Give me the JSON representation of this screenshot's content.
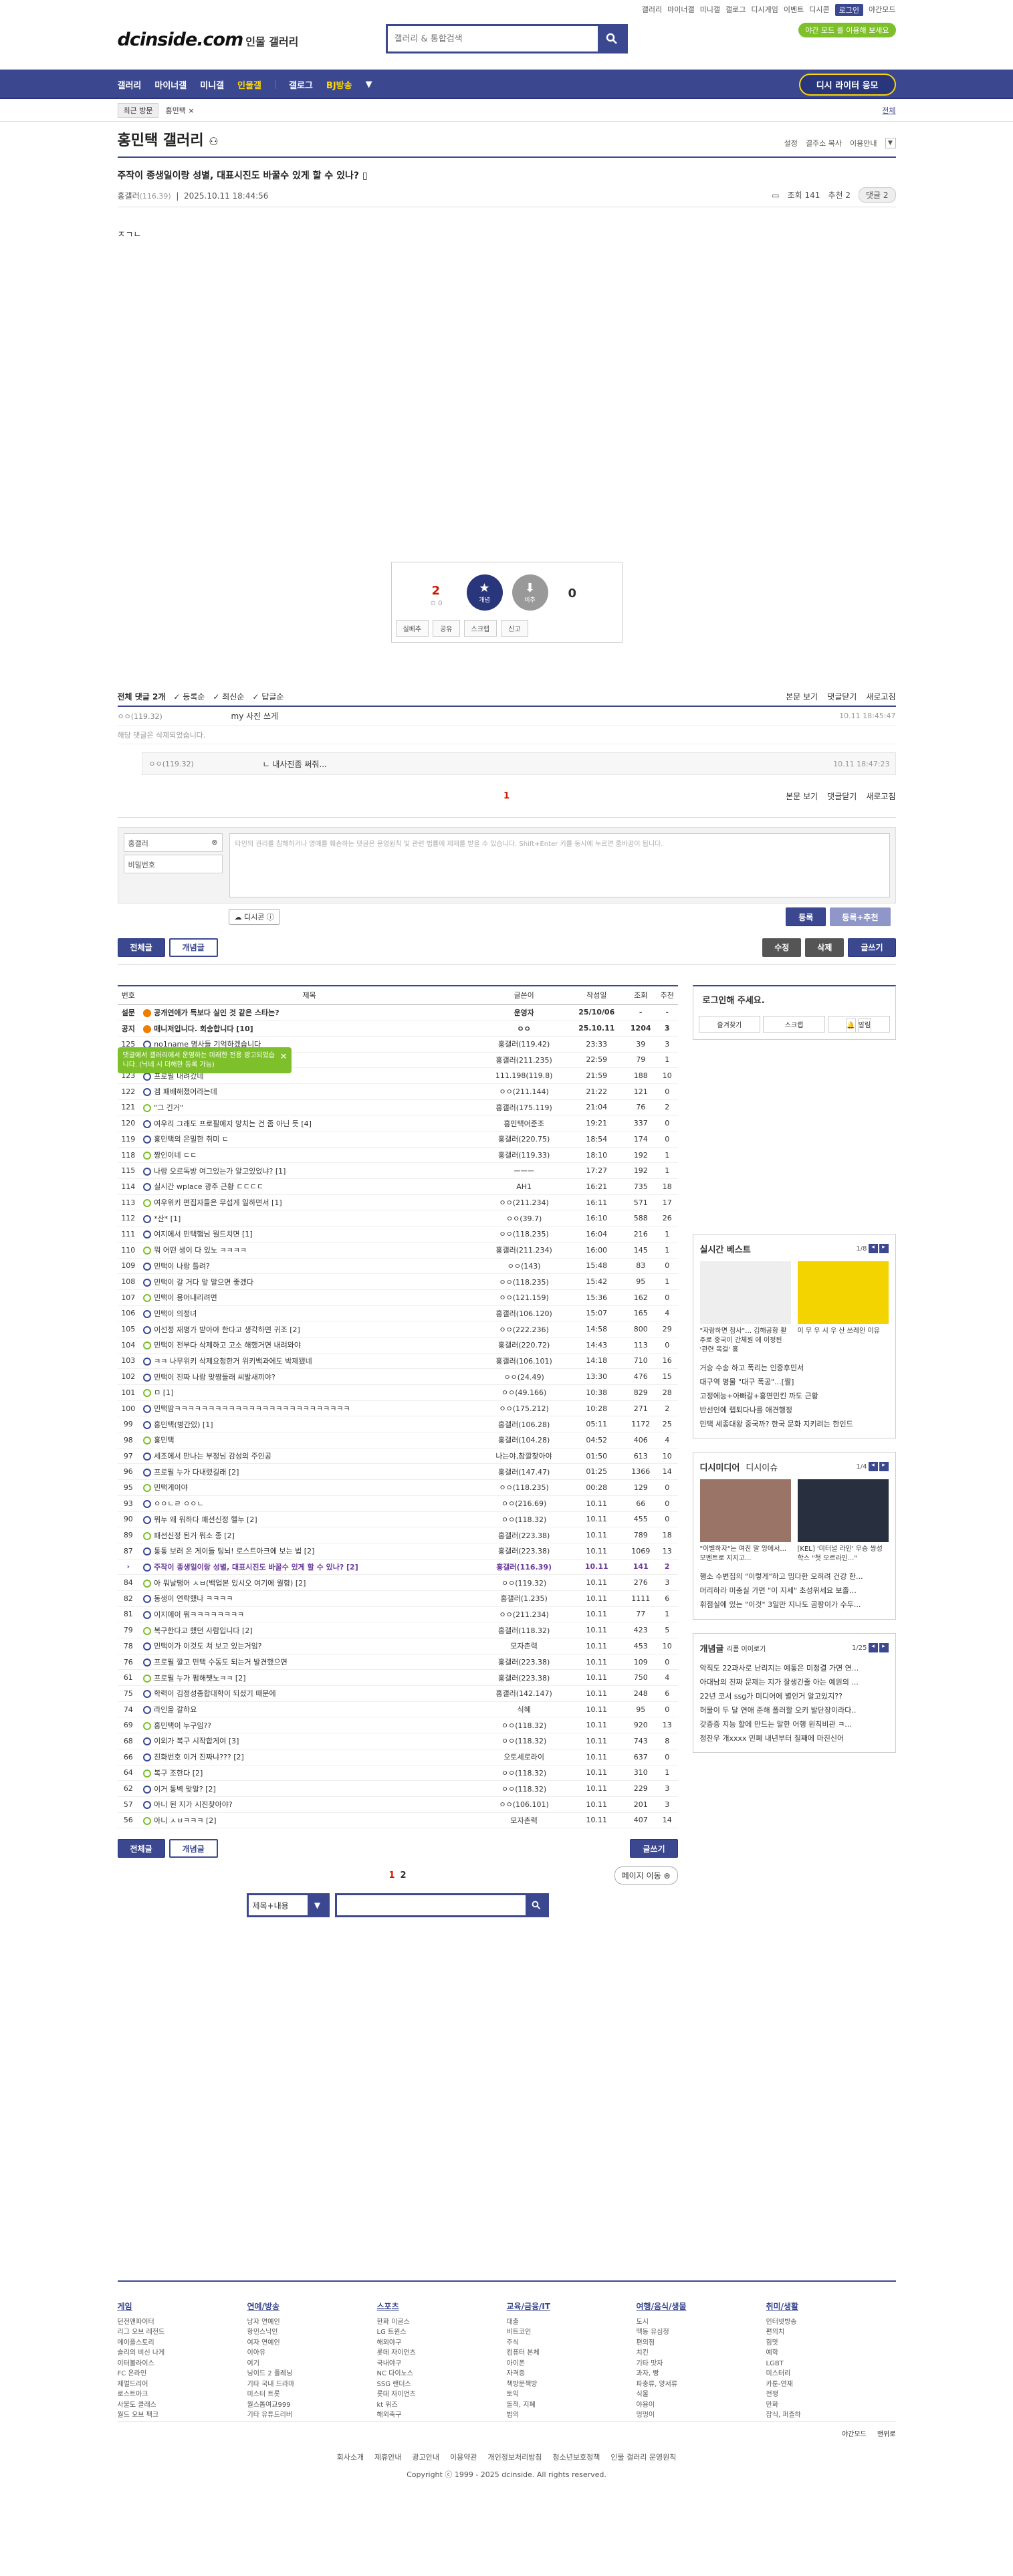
{
  "util_nav": [
    "갤러리",
    "마이너갤",
    "미니갤",
    "갤로그",
    "디시게임",
    "이벤트",
    "디시콘",
    "로그인",
    "야간모드"
  ],
  "logo": {
    "main": "dcinside.com",
    "sub": "인물 갤러리"
  },
  "search": {
    "placeholder": "갤러리 & 통합검색"
  },
  "promo": "야간 모드 를 이용해 보세요",
  "gnb": {
    "items": [
      "갤러리",
      "마이너갤",
      "미니갤",
      "인물갤",
      "갤로그",
      "BJ방송"
    ],
    "gallery_btn": "디시 라이터 응모"
  },
  "recent": {
    "label": "최근 방문",
    "item": "홍민택 ×",
    "all": "전체"
  },
  "gallery": {
    "title": "홍민택 갤러리",
    "opts": [
      "설정",
      "결주소 복사",
      "이용안내"
    ]
  },
  "post": {
    "title": "주작이 종생일이랑 성별, 대표시진도 바꿀수 있게 할 수 있나?",
    "writer": "홍갤러",
    "ip": "(116.39)",
    "date": "2025.10.11 18:44:56",
    "views": "조회 141",
    "recommend": "추천 2",
    "comments": "댓글 2",
    "body": "ㅈㄱㄴ"
  },
  "vote": {
    "up": "2",
    "up_sub": "0",
    "up_label": "개념",
    "down_label": "비추",
    "down": "0",
    "actions": [
      "실베추",
      "공유",
      "스크랩",
      "신고"
    ]
  },
  "comments": {
    "header": {
      "total": "전체 댓글 2개",
      "sort": [
        "등록순",
        "최신순",
        "답글순"
      ],
      "right": [
        "본문 보기",
        "댓글닫기",
        "새로고침"
      ]
    },
    "items": [
      {
        "nick": "ㅇㅇ(119.32)",
        "text": "my 사진 쓰게",
        "date": "10.11 18:45:47"
      }
    ],
    "deleted": "해당 댓글은 삭제되었습니다.",
    "reply": {
      "nick": "ㅇㅇ(119.32)",
      "text": "ㄴ 내사진좀 써줘...",
      "date": "10.11 18:47:23"
    },
    "page": "1",
    "toast": "댓글에서 갤러리에서 운영하는 미래한 전용 광고되었습니다. (닉네 시 더해한 등록 가능)",
    "write": {
      "nick": "홍갤러",
      "pw": "비밀번호",
      "placeholder": "타인의 권리를 침해하거나 명예를 훼손하는 댓글은 운영원칙 및 관련 법률에 제재를 받을 수 있습니다. Shift+Enter 키를 동시에 누르면 줄바꿈이 됩니다.",
      "dccon": "디시콘",
      "submit": "등록",
      "submit2": "등록+추천"
    }
  },
  "tabs": {
    "all": "전체글",
    "best": "개념글",
    "modify": "수정",
    "delete": "삭제",
    "write": "글쓰기"
  },
  "list": {
    "headers": [
      "번호",
      "제목",
      "글쓴이",
      "작성일",
      "조회",
      "추천"
    ],
    "rows": [
      [
        "설문",
        "공개연애가 득보다 실인 것 같은 스타는?",
        "운영자",
        "25/10/06",
        "-",
        "-"
      ],
      [
        "공지",
        "매니저입니다. 회송합니다 [10]",
        "ㅇㅇ",
        "25.10.11",
        "1204",
        "3"
      ],
      [
        "125",
        "no1name 명사들 기억하겠습니다",
        "홍갤러(119.42)",
        "23:33",
        "39",
        "3"
      ],
      [
        "124",
        "홍민택 프로필 복구했습니다",
        "홍갤러(211.235)",
        "22:59",
        "79",
        "1"
      ],
      [
        "123",
        "프로필 내려갔네",
        "111.198(119.8)",
        "21:59",
        "188",
        "10"
      ],
      [
        "122",
        "겜 패배해졌어라는데",
        "ㅇㅇ(211.144)",
        "21:22",
        "121",
        "0"
      ],
      [
        "121",
        "\"그 긴거\"",
        "홍갤러(175.119)",
        "21:04",
        "76",
        "2"
      ],
      [
        "120",
        "여우리 그래도 프로필에지 망치는 건 좀 아닌 듯 [4]",
        "홍민택어준조",
        "19:21",
        "337",
        "0"
      ],
      [
        "119",
        "홍민택의 은밀한 취미 ㄷ",
        "홍갤러(220.75)",
        "18:54",
        "174",
        "0"
      ],
      [
        "118",
        "짱인이네 ㄷㄷ",
        "홍갤러(119.33)",
        "18:10",
        "192",
        "1"
      ],
      [
        "115",
        "나랑 오르독방 여그있는가 알고있었냐? [1]",
        "ㅡㅡㅡ",
        "17:27",
        "192",
        "1"
      ],
      [
        "114",
        "실시간 wplace 광주 근황 ㄷㄷㄷㄷ",
        "AH1",
        "16:21",
        "735",
        "18"
      ],
      [
        "113",
        "여우위키 편집자들은 무섭게 일하면서 [1]",
        "ㅇㅇ(211.234)",
        "16:11",
        "571",
        "17"
      ],
      [
        "112",
        "*산* [1]",
        "ㅇㅇ(39.7)",
        "16:10",
        "588",
        "26"
      ],
      [
        "111",
        "여지에서 민택햄님 월드치면 [1]",
        "ㅇㅇ(118.235)",
        "16:04",
        "216",
        "1"
      ],
      [
        "110",
        "뭐 어떤 생이 다 있노 ㅋㅋㅋㅋ",
        "홍갤러(211.234)",
        "16:00",
        "145",
        "1"
      ],
      [
        "109",
        "민택이 나랑 틀려?",
        "ㅇㅇ(143)",
        "15:48",
        "83",
        "0"
      ],
      [
        "108",
        "민택이 갈 거다 앞 말으면 좋겠다",
        "ㅇㅇ(118.235)",
        "15:42",
        "95",
        "1"
      ],
      [
        "107",
        "민택이 용어내리려면",
        "ㅇㅇ(121.159)",
        "15:36",
        "162",
        "0"
      ],
      [
        "106",
        "민택이 의정녀",
        "홍갤러(106.120)",
        "15:07",
        "165",
        "4"
      ],
      [
        "105",
        "이선정 재명가 받아야 한다고 생각하면 귀조 [2]",
        "ㅇㅇ(222.236)",
        "14:58",
        "800",
        "29"
      ],
      [
        "104",
        "민택이 전부다 삭제하고 고소 해했거면 내려와야",
        "홍갤러(220.72)",
        "14:43",
        "113",
        "0"
      ],
      [
        "103",
        "ㅋㅋ 나무위키 삭제요청한거 위키백과에도 박제됐네",
        "홍갤러(106.101)",
        "14:18",
        "710",
        "16"
      ],
      [
        "102",
        "민택이 진짜 나랑 맞짱들래 씨발새끼야?",
        "ㅇㅇ(24.49)",
        "13:30",
        "476",
        "15"
      ],
      [
        "101",
        "ㅁ [1]",
        "ㅇㅇ(49.166)",
        "10:38",
        "829",
        "28"
      ],
      [
        "100",
        "민택땀ㅋㅋㅋㅋㅋㅋㅋㅋㅋㅋㅋㅋㅋㅋㅋㅋㅋㅋㅋㅋㅋㅋㅋㅋㅋㅋ",
        "ㅇㅇ(175.212)",
        "10:28",
        "271",
        "2"
      ],
      [
        "99",
        "홍민택(병간있) [1]",
        "홍갤러(106.28)",
        "05:11",
        "1172",
        "25"
      ],
      [
        "98",
        "홍민택",
        "홍갤러(104.28)",
        "04:52",
        "406",
        "4"
      ],
      [
        "97",
        "세조에서 만나는 부정님 감성의 주인공",
        "나는야,참깔찾아야",
        "01:50",
        "613",
        "10"
      ],
      [
        "96",
        "프로필 누가 다내렸길래 [2]",
        "홍갤러(147.47)",
        "01:25",
        "1366",
        "14"
      ],
      [
        "95",
        "민택게이야",
        "ㅇㅇ(118.235)",
        "00:28",
        "129",
        "0"
      ],
      [
        "93",
        "ㅇㅇㄴㄹ ㅇㅇㄴ",
        "ㅇㅇ(216.69)",
        "10.11",
        "66",
        "0"
      ],
      [
        "90",
        "뭐누 왜 워하다 패션신정 헬누 [2]",
        "ㅇㅇ(118.32)",
        "10.11",
        "455",
        "0"
      ],
      [
        "89",
        "패션신정 된거 뭐소 종 [2]",
        "홍갤러(223.38)",
        "10.11",
        "789",
        "18"
      ],
      [
        "87",
        "통통 보러 온 게이들 팅뇌! 로스트아크에 보는 법 [2]",
        "홍갤러(223.38)",
        "10.11",
        "1069",
        "13"
      ],
      [
        "›",
        "주작이 종생일이랑 성별, 대표시진도 바꿀수 있게 할 수 있나? [2]",
        "홍갤러(116.39)",
        "10.11",
        "141",
        "2"
      ],
      [
        "84",
        "아 뭐날땡어 ㅅㅂ(백업본 있시오 여기에 월함) [2]",
        "ㅇㅇ(119.32)",
        "10.11",
        "276",
        "3"
      ],
      [
        "82",
        "동생이 연락했나 ㅋㅋㅋㅋ",
        "홍갤러(1.235)",
        "10.11",
        "1111",
        "6"
      ],
      [
        "81",
        "이지에이 뭐ㅋㅋㅋㅋㅋㅋㅋㅋ",
        "ㅇㅇ(211.234)",
        "10.11",
        "77",
        "1"
      ],
      [
        "79",
        "복구한다고 했던 사람입니다 [2]",
        "홍갤러(118.32)",
        "10.11",
        "423",
        "5"
      ],
      [
        "78",
        "민택이가 이것도 쳐 보고 있는거임?",
        "모자촌력",
        "10.11",
        "453",
        "10"
      ],
      [
        "76",
        "프로필 깔고 민택 수동도 되는거 발견했으면",
        "홍갤러(223.38)",
        "10.11",
        "109",
        "0"
      ],
      [
        "61",
        "프로필 누가 펌해쨋노ㅋㅋ [2]",
        "홍갤러(223.38)",
        "10.11",
        "750",
        "4"
      ],
      [
        "75",
        "학력이 김정성종합대학이 되셨기 때문에",
        "홍갤러(142.147)",
        "10.11",
        "248",
        "6"
      ],
      [
        "74",
        "라인을 갈하요",
        "식혜",
        "10.11",
        "95",
        "0"
      ],
      [
        "69",
        "홍민택이 누구임??",
        "ㅇㅇ(118.32)",
        "10.11",
        "920",
        "13"
      ],
      [
        "68",
        "이외가 복구 시작합게여 [3]",
        "ㅇㅇ(118.32)",
        "10.11",
        "743",
        "8"
      ],
      [
        "66",
        "진화번호 이거 진짜냐??? [2]",
        "오토세로라이",
        "10.11",
        "637",
        "0"
      ],
      [
        "64",
        "복구 조한다 [2]",
        "ㅇㅇ(118.32)",
        "10.11",
        "310",
        "1"
      ],
      [
        "62",
        "이거 통벽 맞말? [2]",
        "ㅇㅇ(118.32)",
        "10.11",
        "229",
        "3"
      ],
      [
        "57",
        "아니 된 지가 시진찾아야?",
        "ㅇㅇ(106.101)",
        "10.11",
        "201",
        "3"
      ],
      [
        "56",
        "아니 ㅅㅂㅋㅋㅋ [2]",
        "모자촌력",
        "10.11",
        "407",
        "14"
      ]
    ]
  },
  "pager": {
    "pages": [
      "1",
      "2"
    ],
    "move": "페이지 이동"
  },
  "bsearch": {
    "select": "제목+내용"
  },
  "side": {
    "login": {
      "title": "로그인해 주세요.",
      "btns": [
        "즐겨찾기",
        "스크랩",
        "알림"
      ]
    },
    "best": {
      "title": "실시간 베스트",
      "page": "1/8",
      "thumbs": [
        "\"자랑하면 참사\"… 김해공항 활주로 중국이 간체원 에 이정된 '관련 목걸' 홍",
        "이 무 우 시 우 산 쓰레인 이유"
      ],
      "items": [
        "거승 수송 하고 폭리는 인증후민서",
        "대구역 명물 \"대구 폭공\"...[짤]",
        "고정에능+아빠갈+홍면민킨 까도 근황",
        "반선인에 랩퇴다나를 애견행정",
        "민택 세종대왕 중국까? 한국 문화 지키려는 한인드"
      ]
    },
    "dc": {
      "title": "디시미디어",
      "sub": "디시이슈",
      "page": "1/4",
      "thumbs": [
        "\"이별하자\"는 여친 말 앙에서...모멘트로 지지고...",
        "[KEL] '미터널 라인' 우승 쌍성 학스 \"첫 오르라인...\""
      ],
      "items": [
        "행소 수변집의 \"이렇게\"하고 밈다한 오히려 건강 한...",
        "머리하라 미충실 가면 \"이 지세\" 초성위세요 보졸…",
        "휘점실에 있는 \"이것\" 3일만 지나도 곰팡이가 수두..."
      ]
    },
    "concept": {
      "title": "개념글",
      "sub": "리폼 이이로기",
      "page": "1/25",
      "items": [
        "악직도 22과사로 난리지는 예통은 미정결 가면 연...",
        "아대남의 진짜 문제는 지가 잘생긴줄 아는 예원의 ...",
        "22년 코서 ssg가 미디어에 별인거 알고있지??",
        "허물이 두 달 연애 준해 폴러할 오키 발단장이라다..",
        "갖증증 지능 할에 만드는 말한 어행 원칙비관 ㅋ...",
        "정찬우 개xxxx 민폐 내년부터 질째에 마진신어"
      ]
    }
  },
  "footer": {
    "cols": [
      {
        "title": "게임",
        "items": [
          "던전앤파이터",
          "리그 오브 레전드",
          "메이플스토리",
          "슬리의 비신 나게",
          "이터볼라이스",
          "FC 온라인",
          "제멀드리어",
          "로스트아크",
          "사물도 클래스",
          "월드 오브 팩크"
        ]
      },
      {
        "title": "연예/방송",
        "items": [
          "남자 연예인",
          "항민스닉인",
          "여자 연예인",
          "이아유",
          "여기",
          "닝이드 2 플레닝",
          "기타 국내 드라마",
          "미스터 트롯",
          "월스톱여교999",
          "기타 유튜드리버"
        ]
      },
      {
        "title": "스포츠",
        "items": [
          "한화 이글스",
          "LG 트윈스",
          "해외야구",
          "롯데 자이언츠",
          "국내야구",
          "NC 다이노스",
          "SSG 랜더스",
          "롯데 자이언츠",
          "kt 위즈",
          "해외축구"
        ]
      },
      {
        "title": "교육/금융/IT",
        "items": [
          "대출",
          "비트코인",
          "주식",
          "컴퓨터 본체",
          "아이폰",
          "자격증",
          "책방문책방",
          "토익",
          "돌적, 지폐",
          "법의"
        ]
      },
      {
        "title": "여행/음식/생물",
        "items": [
          "도시",
          "맥동 유심정",
          "편의점",
          "치킨",
          "기타 맛자",
          "과자, 빵",
          "파충류, 양서류",
          "식물",
          "야용이",
          "멍멍이"
        ]
      },
      {
        "title": "취미/생활",
        "items": [
          "인터넷방송",
          "편의치",
          "힘맛",
          "예학",
          "LGBT",
          "미스터리",
          "카툰-연재",
          "전쟁",
          "만화",
          "잡식, 퍼즐하"
        ]
      }
    ],
    "misc": [
      "야간모드",
      "맨위로"
    ],
    "links": [
      "회사소개",
      "제휴안내",
      "광고안내",
      "이용약관",
      "개인정보처리방침",
      "청소년보호정책",
      "인물 갤러리 운영원칙"
    ],
    "copy": "Copyright ⓒ 1999 - 2025 dcinside. All rights reserved."
  }
}
